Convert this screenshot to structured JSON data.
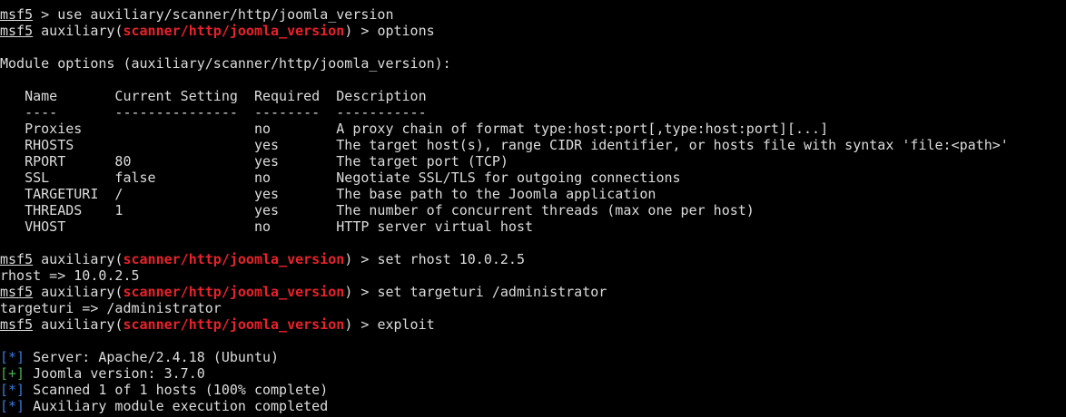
{
  "prompt": {
    "prefix": "msf5",
    "context": "auxiliary",
    "module": "scanner/http/joomla_version",
    "arrow": " > "
  },
  "commands": {
    "use": "use auxiliary/scanner/http/joomla_version",
    "options": "options",
    "set_rhost": "set rhost 10.0.2.5",
    "set_targeturi": "set targeturi /administrator",
    "exploit": "exploit"
  },
  "module_options": {
    "heading": "Module options (auxiliary/scanner/http/joomla_version):",
    "header_line": "   Name       Current Setting  Required  Description",
    "separator_line": "   ----       ---------------  --------  -----------",
    "rows": [
      "   Proxies                     no        A proxy chain of format type:host:port[,type:host:port][...]",
      "   RHOSTS                      yes       The target host(s), range CIDR identifier, or hosts file with syntax 'file:<path>'",
      "   RPORT      80               yes       The target port (TCP)",
      "   SSL        false            no        Negotiate SSL/TLS for outgoing connections",
      "   TARGETURI  /                yes       The base path to the Joomla application",
      "   THREADS    1                yes       The number of concurrent threads (max one per host)",
      "   VHOST                       no        HTTP server virtual host"
    ]
  },
  "responses": {
    "rhost": "rhost => 10.0.2.5",
    "targeturi": "targeturi => /administrator"
  },
  "results": [
    {
      "marker": "[*]",
      "text": " Server: Apache/2.4.18 (Ubuntu)",
      "color": "#3c78d8"
    },
    {
      "marker": "[+]",
      "text": " Joomla version: 3.7.0",
      "color": "#4caf50"
    },
    {
      "marker": "[*]",
      "text": " Scanned 1 of 1 hosts (100% complete)",
      "color": "#3c78d8"
    },
    {
      "marker": "[*]",
      "text": " Auxiliary module execution completed",
      "color": "#3c78d8"
    }
  ],
  "colors": {
    "background": "#000000",
    "foreground": "#dcdcdc",
    "module_red": "#e8222a",
    "info_blue": "#3c78d8",
    "success_green": "#4caf50"
  }
}
